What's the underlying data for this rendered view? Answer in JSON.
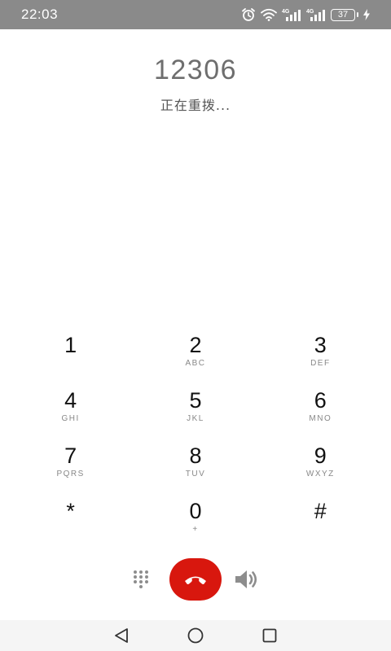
{
  "status_bar": {
    "time": "22:03",
    "network_1": "4G",
    "network_2": "4G",
    "battery": "37"
  },
  "call": {
    "number": "12306",
    "status": "正在重拨..."
  },
  "keypad": {
    "keys": [
      {
        "digit": "1",
        "letters": ""
      },
      {
        "digit": "2",
        "letters": "ABC"
      },
      {
        "digit": "3",
        "letters": "DEF"
      },
      {
        "digit": "4",
        "letters": "GHI"
      },
      {
        "digit": "5",
        "letters": "JKL"
      },
      {
        "digit": "6",
        "letters": "MNO"
      },
      {
        "digit": "7",
        "letters": "PQRS"
      },
      {
        "digit": "8",
        "letters": "TUV"
      },
      {
        "digit": "9",
        "letters": "WXYZ"
      },
      {
        "digit": "*",
        "letters": ""
      },
      {
        "digit": "0",
        "letters": "+"
      },
      {
        "digit": "#",
        "letters": ""
      }
    ]
  },
  "colors": {
    "status_bar_bg": "#8a8a8a",
    "end_call": "#d8170e",
    "number_text": "#6e6e6e",
    "key_sub_text": "#888888"
  },
  "icons": {
    "dialpad": "dialpad-icon",
    "end_call": "phone-hangup-icon",
    "speaker": "speaker-icon",
    "back": "nav-back-icon",
    "home": "nav-home-icon",
    "recents": "nav-recents-icon"
  }
}
